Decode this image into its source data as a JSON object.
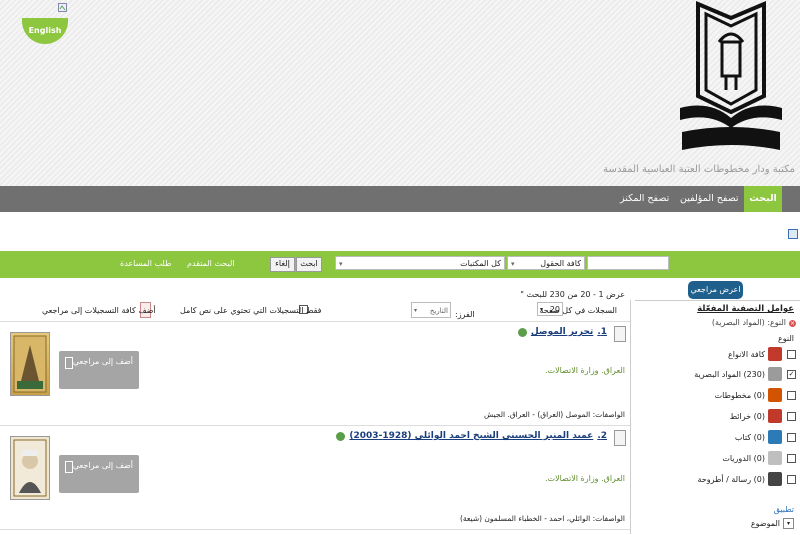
{
  "header": {
    "english_label": "English",
    "library_title": "مكتبة ودار مخطوطات العتبة العباسية المقدسة",
    "logo_text": "مكتبة ودار مخطوطات العتبة العباسية المقدسة"
  },
  "nav": {
    "search": "البحث",
    "browse_authors": "تصفح المؤلفين",
    "browse_treasury": "تصفح المكنز"
  },
  "search": {
    "query_value": "",
    "field_select": "كافة الحقول",
    "collection_select": "كل المكتبات",
    "search_button": "ابحث",
    "cancel_button": "إلغاء",
    "advanced_search": "البحث المتقدم",
    "help": "طلب المساعدة"
  },
  "sidebar": {
    "bookbag_button": "اعرض مراجعي",
    "facets_title": "عوامل التصفية المفعّلة",
    "active_facet": "النوع: (المواد البصرية)",
    "type_heading": "النوع",
    "types": [
      {
        "label": "كافة الانواع",
        "checked": false,
        "icon_color": "#c0392b"
      },
      {
        "label": "(230) المواد البصرية",
        "checked": true,
        "icon_color": "#9b9b9b"
      },
      {
        "label": "(0) مخطوطات",
        "checked": false,
        "icon_color": "#d35400"
      },
      {
        "label": "(0) خرائط",
        "checked": false,
        "icon_color": "#c0392b"
      },
      {
        "label": "(0) كتاب",
        "checked": false,
        "icon_color": "#2c7bb6"
      },
      {
        "label": "(0) الدوريات",
        "checked": false,
        "icon_color": "#bfbfbf"
      },
      {
        "label": "(0) رسالة / أطروحة",
        "checked": false,
        "icon_color": "#444444"
      }
    ],
    "apply_heading": "تطبيق",
    "subject_heading": "الموضوع"
  },
  "results": {
    "count_text": "عرض 1 - 20  من 230  للبحث \"",
    "per_page_label": "السجلات في كل صفحة",
    "per_page_value": "20",
    "sort_label": "الفرز:",
    "sort_value": "التاريخ",
    "fulltext_label": "فقط التسجيلات التي تحتوي على نص كامل",
    "add_all_label": "أضف كافة التسجيلات إلى مراجعي",
    "records": [
      {
        "number": "1.",
        "title": "تحرير الموصل",
        "publisher": "العراق. وزارة الاتصالات.",
        "descriptors": "الواصفات: الموصل (العراق) - العراق. الجيش",
        "add_label": "أضف إلى مراجعي"
      },
      {
        "number": "2.",
        "title": "عميد المنبر الحسيني الشيخ احمد الوائلي (1928-2003)",
        "publisher": "العراق. وزارة الاتصالات.",
        "descriptors": "الواصفات: الوائلي، احمد - الخطباء المسلمون (شيعة)",
        "add_label": "أضف إلى مراجعي"
      }
    ]
  }
}
